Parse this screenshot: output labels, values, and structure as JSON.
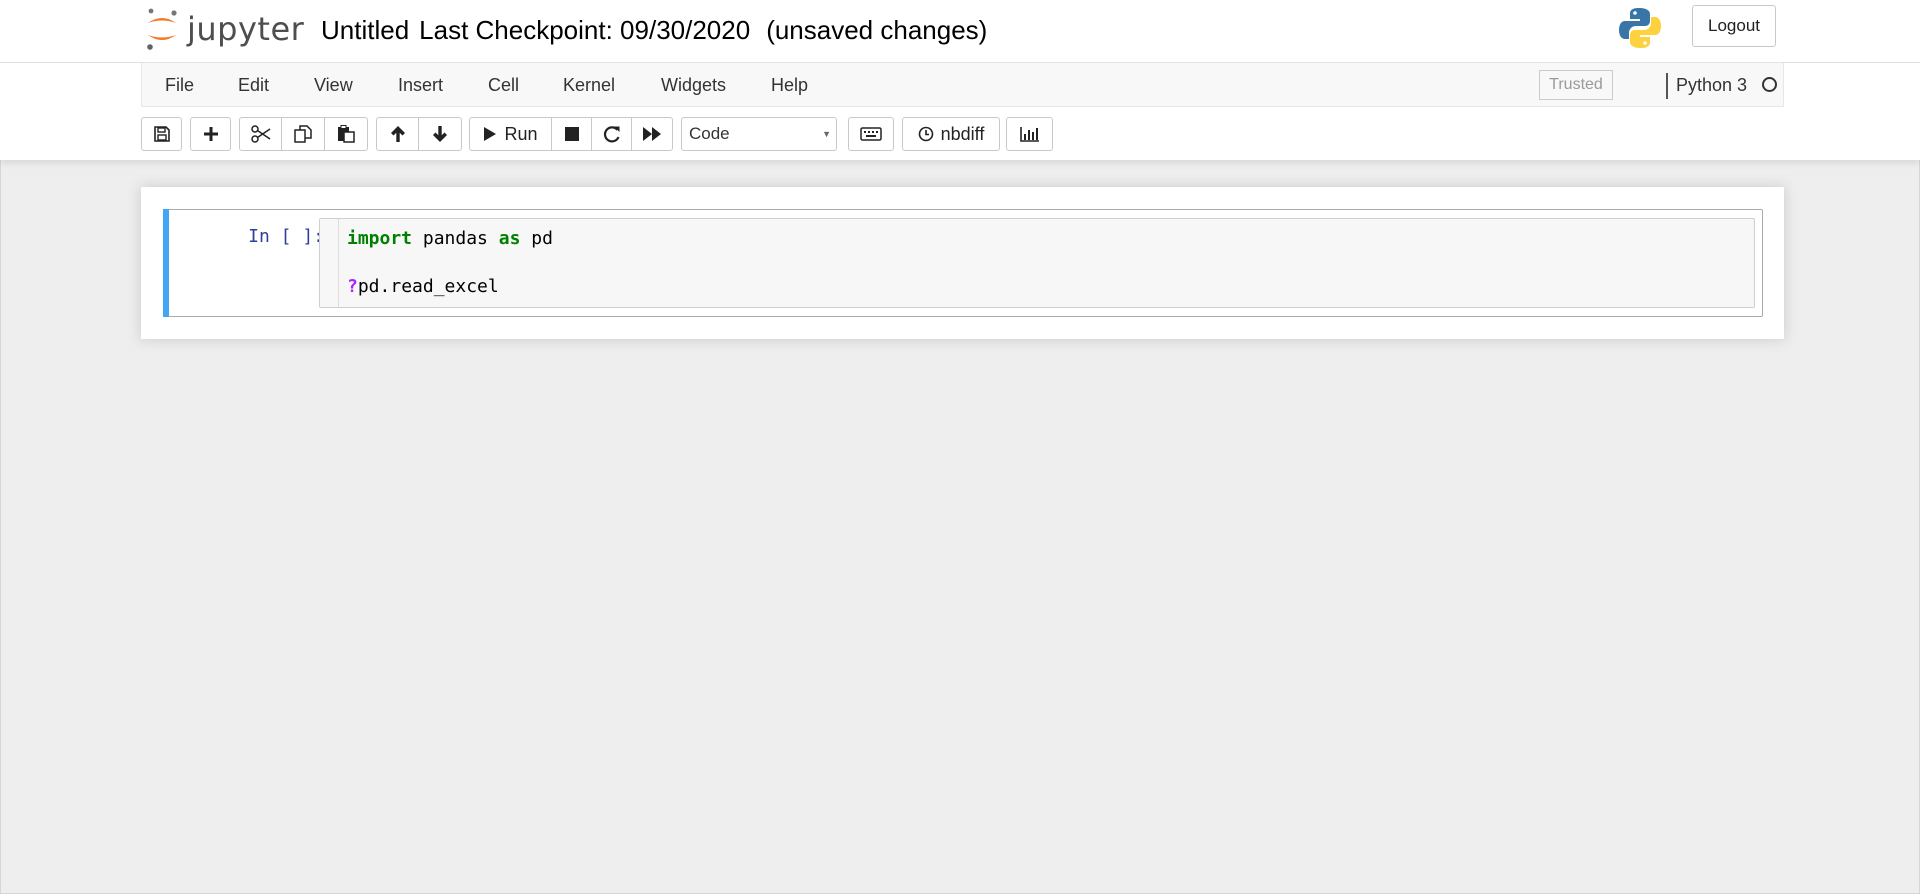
{
  "header": {
    "logo_text": "jupyter",
    "notebook_name": "Untitled",
    "checkpoint": "Last Checkpoint: 09/30/2020",
    "autosave_status": "(unsaved changes)",
    "logout_label": "Logout"
  },
  "menubar": {
    "items": [
      "File",
      "Edit",
      "View",
      "Insert",
      "Cell",
      "Kernel",
      "Widgets",
      "Help"
    ],
    "trusted_label": "Trusted",
    "kernel_name": "Python 3"
  },
  "toolbar": {
    "run_label": "Run",
    "cell_type": "Code",
    "nbdiff_label": "nbdiff"
  },
  "cells": [
    {
      "prompt": "In [ ]:",
      "lines": [
        [
          {
            "text": "import",
            "cls": "kw"
          },
          {
            "text": " pandas ",
            "cls": ""
          },
          {
            "text": "as",
            "cls": "kw"
          },
          {
            "text": " pd",
            "cls": ""
          }
        ],
        [],
        [
          {
            "text": "?",
            "cls": "op"
          },
          {
            "text": "pd.read_excel",
            "cls": ""
          }
        ]
      ]
    }
  ],
  "colors": {
    "accent_blue": "#42a5f5",
    "prompt_blue": "#303f9f",
    "keyword_green": "#008000",
    "operator_purple": "#aa22ff",
    "jupyter_orange": "#f37726"
  },
  "icons": {
    "save": "floppy-disk-icon",
    "add": "plus-icon",
    "cut": "scissors-icon",
    "copy": "copy-icon",
    "paste": "paste-icon",
    "up": "arrow-up-icon",
    "down": "arrow-down-icon",
    "run": "play-icon",
    "stop": "stop-icon",
    "restart": "restart-icon",
    "fast_forward": "fast-forward-icon",
    "keyboard": "keyboard-icon",
    "nbdiff": "clock-icon",
    "chart": "bar-chart-icon"
  }
}
